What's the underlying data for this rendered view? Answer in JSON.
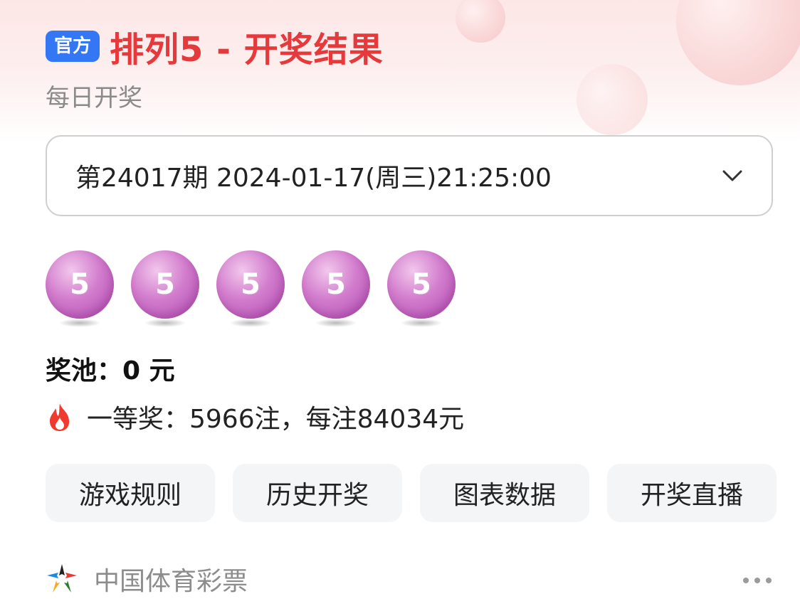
{
  "header": {
    "badge": "官方",
    "title": "排列5 - 开奖结果",
    "subtitle": "每日开奖"
  },
  "draw_selector": {
    "value": "第24017期 2024-01-17(周三)21:25:00",
    "icon": "chevron-down-icon"
  },
  "balls": [
    "5",
    "5",
    "5",
    "5",
    "5"
  ],
  "pool": {
    "text": "奖池：0 元"
  },
  "first_prize": {
    "icon": "fire-icon",
    "text": "一等奖：5966注，每注84034元"
  },
  "actions": [
    {
      "label": "游戏规则"
    },
    {
      "label": "历史开奖"
    },
    {
      "label": "图表数据"
    },
    {
      "label": "开奖直播"
    }
  ],
  "footer": {
    "brand": "中国体育彩票",
    "more_icon": "more-icon"
  },
  "colors": {
    "title_red": "#e5393b",
    "badge_blue": "#3477f5",
    "ball_purple": "#c45fc1"
  }
}
